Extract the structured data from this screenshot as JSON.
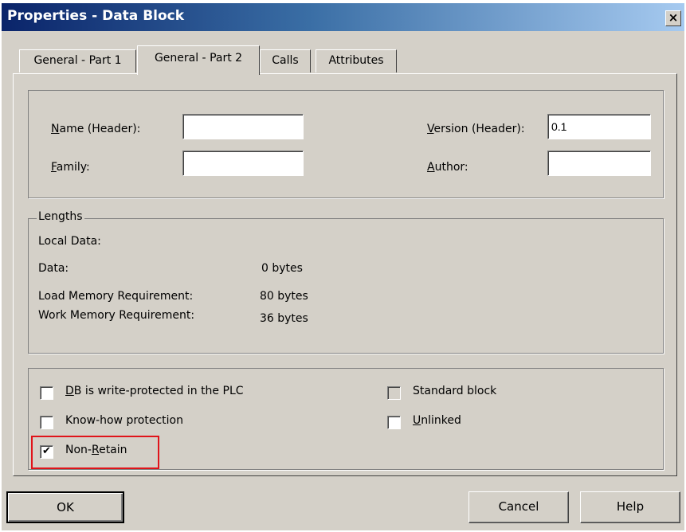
{
  "window": {
    "title": "Properties - Data Block",
    "close_glyph": "×"
  },
  "tabs": [
    {
      "label": "General - Part 1"
    },
    {
      "label": "General - Part 2",
      "active": true
    },
    {
      "label": "Calls"
    },
    {
      "label": "Attributes"
    }
  ],
  "header": {
    "name_label_first": "N",
    "name_label_rest": "ame (Header):",
    "name_value": "",
    "family_label_first": "F",
    "family_label_rest": "amily:",
    "family_value": "",
    "version_label_first": "V",
    "version_label_rest": "ersion (Header):",
    "version_value": "0.1",
    "author_label_first": "A",
    "author_label_rest": "uthor:",
    "author_value": ""
  },
  "lengths": {
    "legend": "Lengths",
    "local_data_label": "Local Data:",
    "data_label": "Data:",
    "data_value": "0 bytes",
    "load_label": "Load Memory Requirement:",
    "load_value": "80 bytes",
    "work_label": "Work Memory Requirement:",
    "work_value": "36 bytes"
  },
  "options": {
    "write_protected": {
      "label_first": "D",
      "label_rest": "B is write-protected in the PLC",
      "checked": false
    },
    "know_how": {
      "label": "Know-how protection",
      "checked": false
    },
    "non_retain": {
      "label_pre": "Non-",
      "label_first": "R",
      "label_rest": "etain",
      "checked": true,
      "check_glyph": "✔"
    },
    "standard_block": {
      "label": "Standard block",
      "checked": false
    },
    "unlinked": {
      "label_first": "U",
      "label_rest": "nlinked",
      "checked": false
    }
  },
  "buttons": {
    "ok": "OK",
    "cancel": "Cancel",
    "help": "Help"
  },
  "colors": {
    "highlight": "#e0141a",
    "titlebar_start": "#0a246a",
    "dialog_face": "#d4d0c8"
  }
}
